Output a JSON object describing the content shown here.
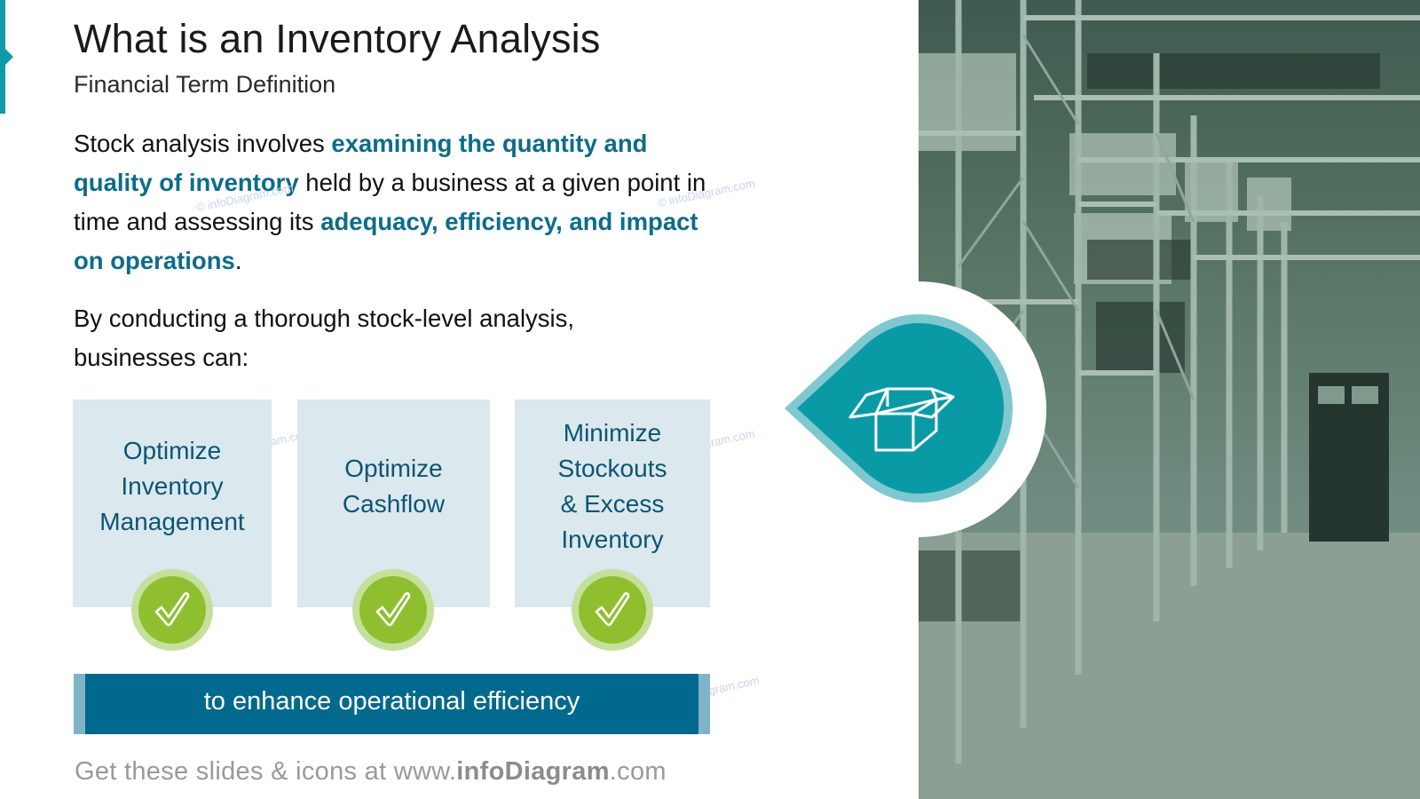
{
  "slide": {
    "title": "What is an Inventory Analysis",
    "subtitle": "Financial Term Definition",
    "paragraph1": {
      "segments": [
        {
          "text": "Stock analysis involves ",
          "highlight": false
        },
        {
          "text": "examining the quantity and quality of inventory",
          "highlight": true
        },
        {
          "text": " held by a business at a given point in time and assessing its ",
          "highlight": false
        },
        {
          "text": "adequacy, efficiency, and impact on operations",
          "highlight": true
        },
        {
          "text": ".",
          "highlight": false
        }
      ]
    },
    "paragraph2": "By conducting a thorough stock-level analysis, businesses can:",
    "benefits": [
      {
        "lines": [
          "Optimize",
          "Inventory",
          "Management"
        ],
        "icon": "check-icon"
      },
      {
        "lines": [
          "Optimize",
          "Cashflow"
        ],
        "icon": "check-icon"
      },
      {
        "lines": [
          "Minimize",
          "Stockouts",
          "& Excess",
          "Inventory"
        ],
        "icon": "check-icon"
      }
    ],
    "banner": "to enhance operational efficiency",
    "center_icon": "open-box-icon",
    "photo": "warehouse-shelves-photo",
    "footer": {
      "prefix": "Get these slides & icons at www.",
      "brand": "infoDiagram",
      "suffix": ".com"
    },
    "watermark": "© infoDiagram.com"
  },
  "colors": {
    "accent_teal": "#0e9aa7",
    "highlight_blue": "#0d6c8a",
    "box_bg": "#dbe8ee",
    "check_green": "#8fbf2e",
    "banner_blue": "#02698e"
  }
}
